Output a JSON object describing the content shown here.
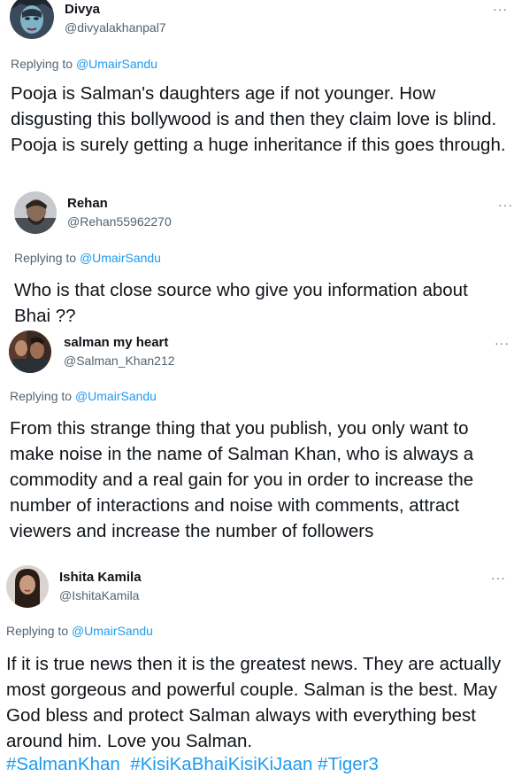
{
  "replies": [
    {
      "name": "Divya",
      "handle": "@divyalakhanpal7",
      "replying_prefix": "Replying to ",
      "replying_to": "@UmairSandu",
      "text": "Pooja is Salman's daughters age if not younger. How disgusting this bollywood is and then they claim love is blind. Pooja is surely getting a huge inheritance if this goes through."
    },
    {
      "name": "Rehan",
      "handle": "@Rehan55962270",
      "replying_prefix": "Replying to ",
      "replying_to": "@UmairSandu",
      "text": "Who is that close source who give you information about Bhai ??"
    },
    {
      "name": "salman my heart",
      "handle": "@Salman_Khan212",
      "replying_prefix": "Replying to ",
      "replying_to": "@UmairSandu",
      "text": "From this strange thing that you publish, you only want to make noise in the name of Salman Khan, who is always a commodity and a real gain for you in order to increase the number of interactions and noise with comments, attract viewers and increase the number of followers"
    },
    {
      "name": "Ishita Kamila",
      "handle": "@IshitaKamila",
      "replying_prefix": "Replying to ",
      "replying_to": "@UmairSandu",
      "text": "If it is true news then it is the greatest news. They are actually most gorgeous and powerful couple. Salman is the best. May God bless and protect Salman always with everything best around him. Love you Salman.",
      "hashtags": [
        "#SalmanKhan",
        "#KisiKaBhaiKisiKiJaan",
        "#Tiger3"
      ]
    }
  ],
  "more_glyph": "···",
  "colors": {
    "mention": "#1d9bf0",
    "secondary": "#536471",
    "text": "#0f1419"
  },
  "icons": {
    "more": "more-dots-icon"
  }
}
